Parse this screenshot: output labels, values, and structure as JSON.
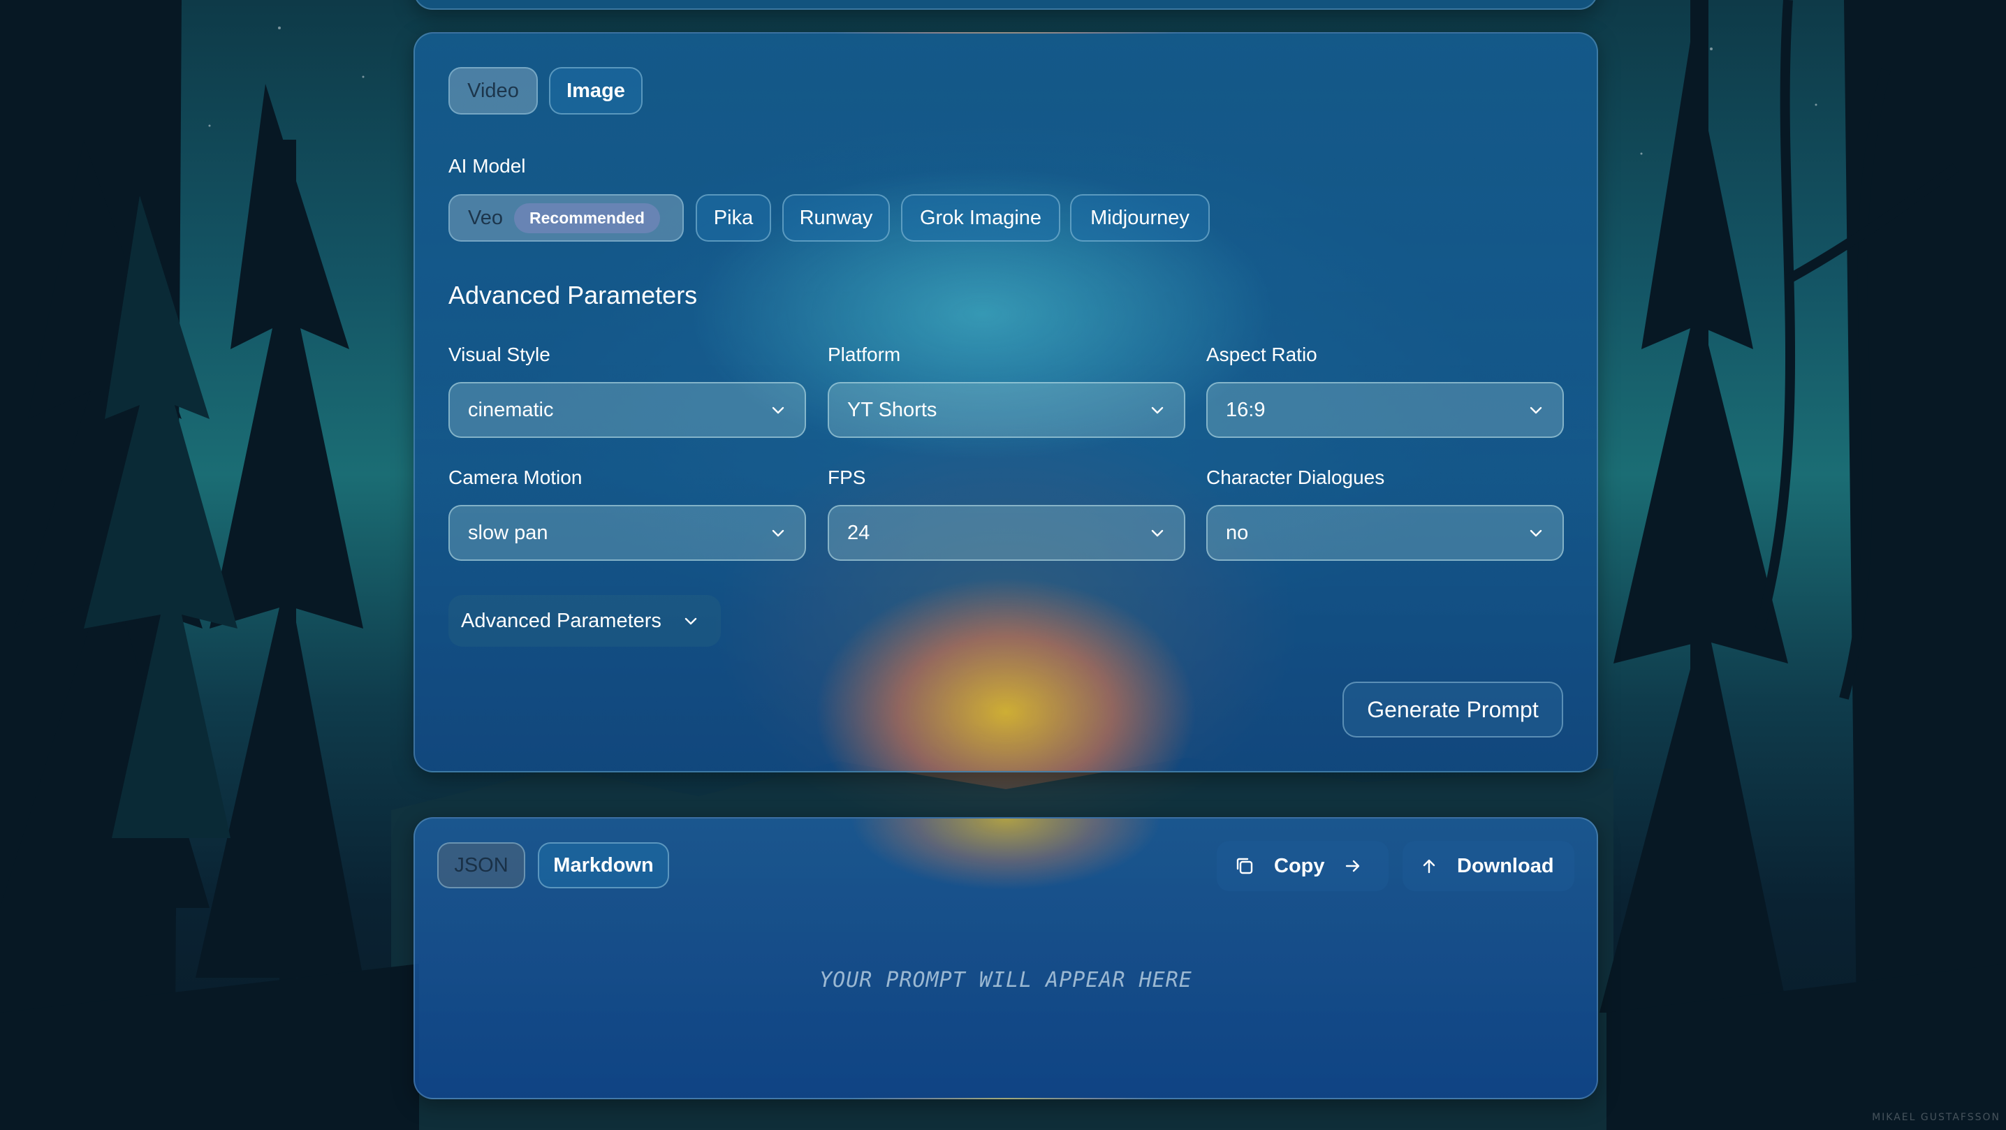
{
  "mode_tabs": [
    {
      "label": "Video",
      "active": true
    },
    {
      "label": "Image",
      "active": false
    }
  ],
  "ai_model": {
    "label": "AI Model",
    "options": [
      {
        "label": "Veo",
        "badge": "Recommended",
        "active": true
      },
      {
        "label": "Pika"
      },
      {
        "label": "Runway"
      },
      {
        "label": "Grok Imagine"
      },
      {
        "label": "Midjourney"
      }
    ]
  },
  "advanced": {
    "heading": "Advanced Parameters",
    "fields": [
      {
        "label": "Visual Style",
        "value": "cinematic"
      },
      {
        "label": "Platform",
        "value": "YT Shorts"
      },
      {
        "label": "Aspect Ratio",
        "value": "16:9"
      },
      {
        "label": "Camera Motion",
        "value": "slow pan"
      },
      {
        "label": "FPS",
        "value": "24"
      },
      {
        "label": "Character Dialogues",
        "value": "no"
      }
    ],
    "toggle_label": "Advanced Parameters"
  },
  "generate_label": "Generate Prompt",
  "output": {
    "format_tabs": [
      {
        "label": "JSON",
        "active": true
      },
      {
        "label": "Markdown",
        "active": false
      }
    ],
    "copy_label": "Copy",
    "download_label": "Download",
    "placeholder": "YOUR PROMPT WILL APPEAR HERE"
  },
  "watermark": "MIKAEL GUSTAFSSON",
  "icons": {
    "chevron": "chevron-down-icon",
    "copy": "copy-icon",
    "arrow": "arrow-right-icon",
    "upload": "arrow-up-icon"
  },
  "colors": {
    "panel": "#1a5f96",
    "glow_yellow": "#ecbe28",
    "glow_red": "#ec7846"
  }
}
